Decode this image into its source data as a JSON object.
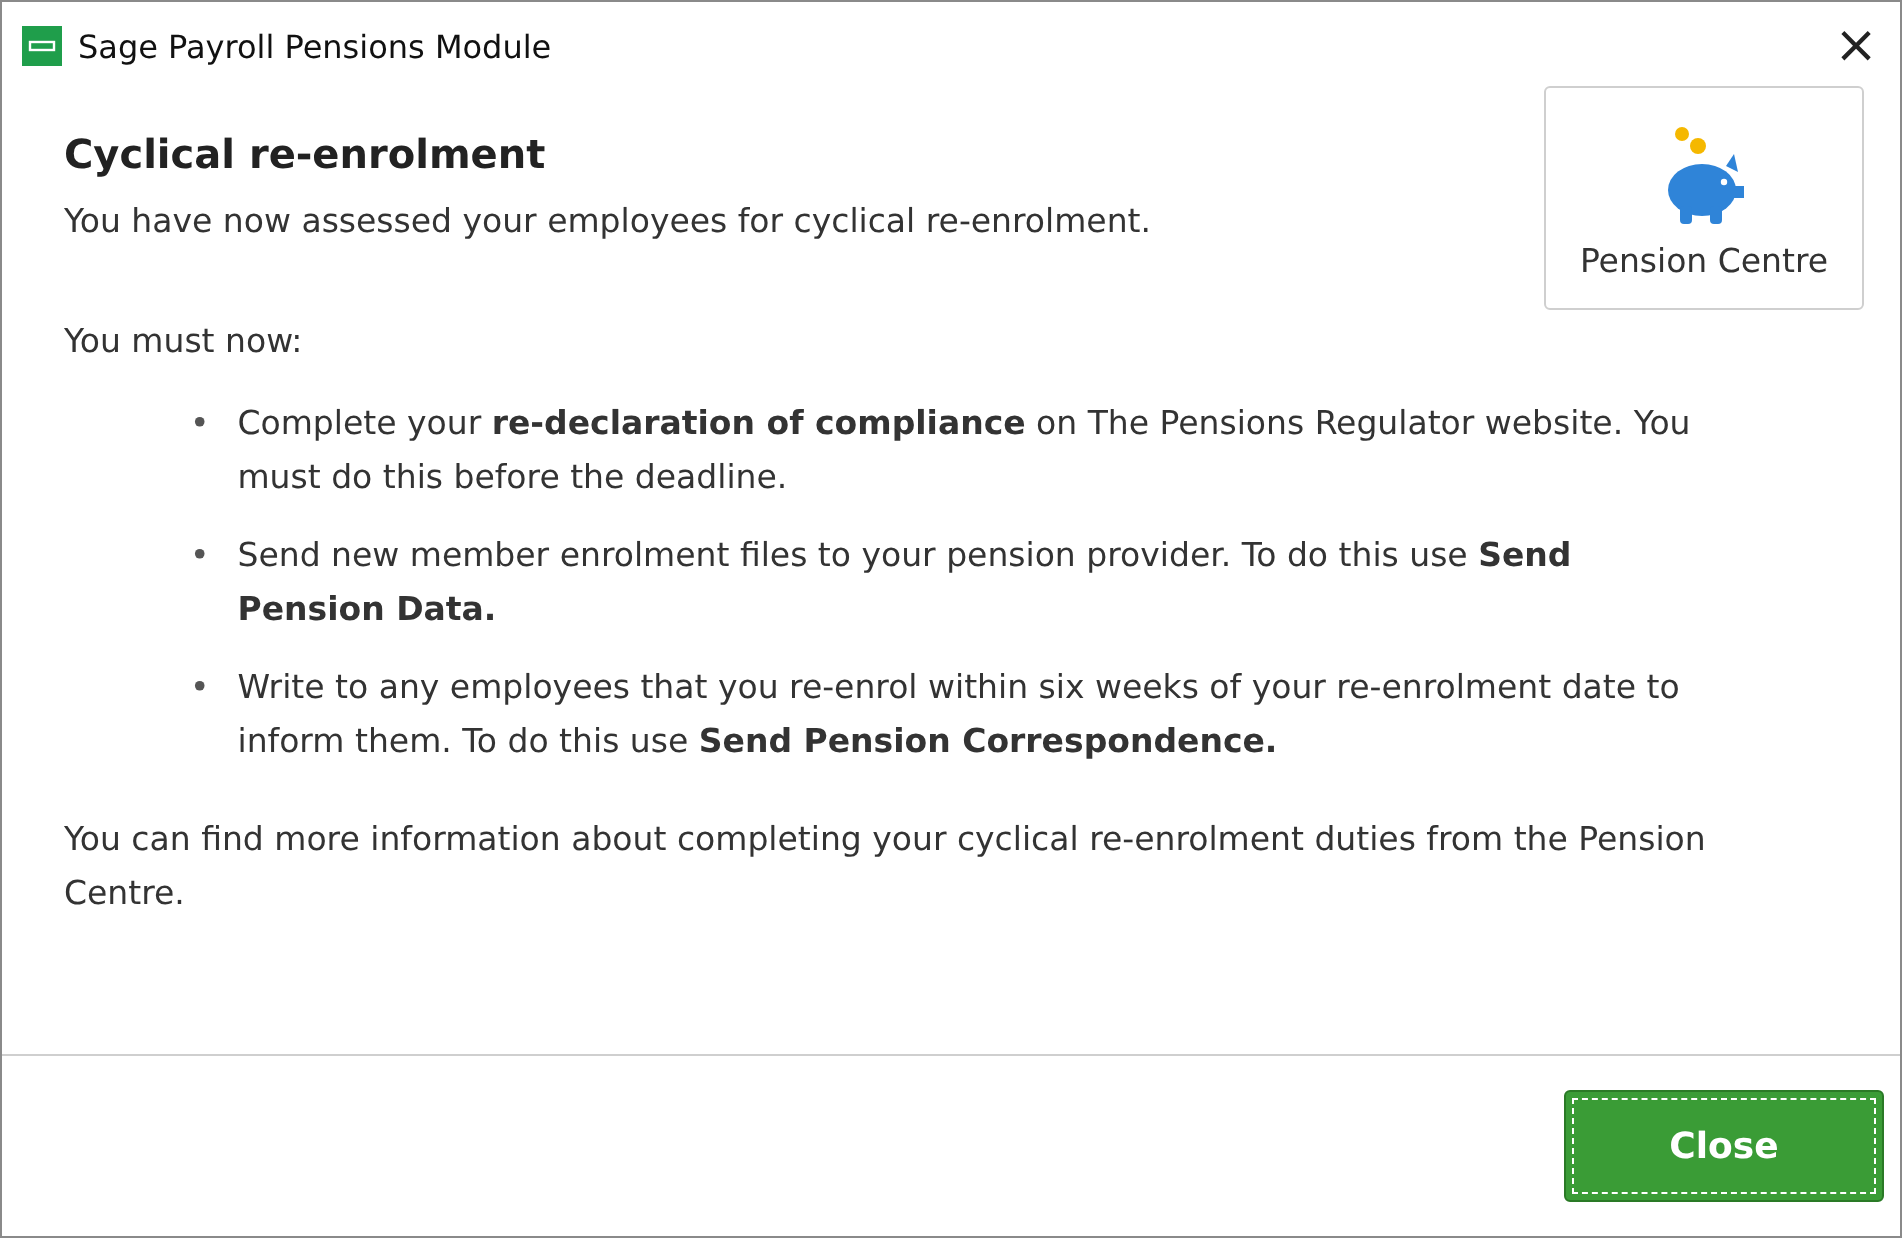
{
  "window": {
    "title": "Sage Payroll Pensions Module",
    "close": "×"
  },
  "heading": "Cyclical re-enrolment",
  "intro": "You have now assessed your employees for cyclical re-enrolment.",
  "pension_centre_button": {
    "label": "Pension Centre"
  },
  "lead": "You must now:",
  "bullets": [
    {
      "marker": "•",
      "text": "Complete your **re-declaration of compliance** on The Pensions Regulator website. You must do this before the deadline."
    },
    {
      "marker": "•",
      "text": "Send new member enrolment files to your pension provider. To do this use **Send Pension Data.**"
    },
    {
      "marker": "•",
      "text": "Write to any employees that you re-enrol within six weeks of your re-enrolment date to inform them. To do this use **Send Pension Correspondence.**"
    }
  ],
  "footnote": "You can find more information about completing your cyclical re-enrolment duties from the Pension Centre.",
  "footer": {
    "close_button": {
      "label": "Close",
      "focused": true
    }
  }
}
